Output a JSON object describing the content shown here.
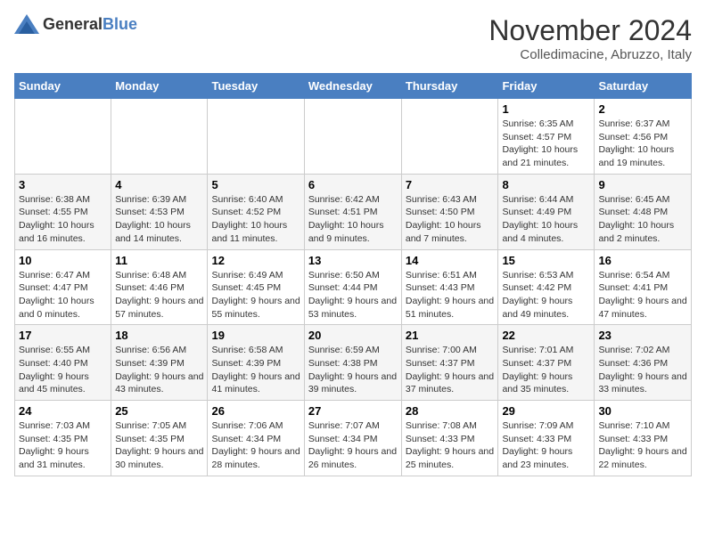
{
  "logo": {
    "text_general": "General",
    "text_blue": "Blue"
  },
  "title": {
    "month": "November 2024",
    "location": "Colledimacine, Abruzzo, Italy"
  },
  "headers": [
    "Sunday",
    "Monday",
    "Tuesday",
    "Wednesday",
    "Thursday",
    "Friday",
    "Saturday"
  ],
  "weeks": [
    [
      {
        "day": "",
        "sunrise": "",
        "sunset": "",
        "daylight": ""
      },
      {
        "day": "",
        "sunrise": "",
        "sunset": "",
        "daylight": ""
      },
      {
        "day": "",
        "sunrise": "",
        "sunset": "",
        "daylight": ""
      },
      {
        "day": "",
        "sunrise": "",
        "sunset": "",
        "daylight": ""
      },
      {
        "day": "",
        "sunrise": "",
        "sunset": "",
        "daylight": ""
      },
      {
        "day": "1",
        "sunrise": "Sunrise: 6:35 AM",
        "sunset": "Sunset: 4:57 PM",
        "daylight": "Daylight: 10 hours and 21 minutes."
      },
      {
        "day": "2",
        "sunrise": "Sunrise: 6:37 AM",
        "sunset": "Sunset: 4:56 PM",
        "daylight": "Daylight: 10 hours and 19 minutes."
      }
    ],
    [
      {
        "day": "3",
        "sunrise": "Sunrise: 6:38 AM",
        "sunset": "Sunset: 4:55 PM",
        "daylight": "Daylight: 10 hours and 16 minutes."
      },
      {
        "day": "4",
        "sunrise": "Sunrise: 6:39 AM",
        "sunset": "Sunset: 4:53 PM",
        "daylight": "Daylight: 10 hours and 14 minutes."
      },
      {
        "day": "5",
        "sunrise": "Sunrise: 6:40 AM",
        "sunset": "Sunset: 4:52 PM",
        "daylight": "Daylight: 10 hours and 11 minutes."
      },
      {
        "day": "6",
        "sunrise": "Sunrise: 6:42 AM",
        "sunset": "Sunset: 4:51 PM",
        "daylight": "Daylight: 10 hours and 9 minutes."
      },
      {
        "day": "7",
        "sunrise": "Sunrise: 6:43 AM",
        "sunset": "Sunset: 4:50 PM",
        "daylight": "Daylight: 10 hours and 7 minutes."
      },
      {
        "day": "8",
        "sunrise": "Sunrise: 6:44 AM",
        "sunset": "Sunset: 4:49 PM",
        "daylight": "Daylight: 10 hours and 4 minutes."
      },
      {
        "day": "9",
        "sunrise": "Sunrise: 6:45 AM",
        "sunset": "Sunset: 4:48 PM",
        "daylight": "Daylight: 10 hours and 2 minutes."
      }
    ],
    [
      {
        "day": "10",
        "sunrise": "Sunrise: 6:47 AM",
        "sunset": "Sunset: 4:47 PM",
        "daylight": "Daylight: 10 hours and 0 minutes."
      },
      {
        "day": "11",
        "sunrise": "Sunrise: 6:48 AM",
        "sunset": "Sunset: 4:46 PM",
        "daylight": "Daylight: 9 hours and 57 minutes."
      },
      {
        "day": "12",
        "sunrise": "Sunrise: 6:49 AM",
        "sunset": "Sunset: 4:45 PM",
        "daylight": "Daylight: 9 hours and 55 minutes."
      },
      {
        "day": "13",
        "sunrise": "Sunrise: 6:50 AM",
        "sunset": "Sunset: 4:44 PM",
        "daylight": "Daylight: 9 hours and 53 minutes."
      },
      {
        "day": "14",
        "sunrise": "Sunrise: 6:51 AM",
        "sunset": "Sunset: 4:43 PM",
        "daylight": "Daylight: 9 hours and 51 minutes."
      },
      {
        "day": "15",
        "sunrise": "Sunrise: 6:53 AM",
        "sunset": "Sunset: 4:42 PM",
        "daylight": "Daylight: 9 hours and 49 minutes."
      },
      {
        "day": "16",
        "sunrise": "Sunrise: 6:54 AM",
        "sunset": "Sunset: 4:41 PM",
        "daylight": "Daylight: 9 hours and 47 minutes."
      }
    ],
    [
      {
        "day": "17",
        "sunrise": "Sunrise: 6:55 AM",
        "sunset": "Sunset: 4:40 PM",
        "daylight": "Daylight: 9 hours and 45 minutes."
      },
      {
        "day": "18",
        "sunrise": "Sunrise: 6:56 AM",
        "sunset": "Sunset: 4:39 PM",
        "daylight": "Daylight: 9 hours and 43 minutes."
      },
      {
        "day": "19",
        "sunrise": "Sunrise: 6:58 AM",
        "sunset": "Sunset: 4:39 PM",
        "daylight": "Daylight: 9 hours and 41 minutes."
      },
      {
        "day": "20",
        "sunrise": "Sunrise: 6:59 AM",
        "sunset": "Sunset: 4:38 PM",
        "daylight": "Daylight: 9 hours and 39 minutes."
      },
      {
        "day": "21",
        "sunrise": "Sunrise: 7:00 AM",
        "sunset": "Sunset: 4:37 PM",
        "daylight": "Daylight: 9 hours and 37 minutes."
      },
      {
        "day": "22",
        "sunrise": "Sunrise: 7:01 AM",
        "sunset": "Sunset: 4:37 PM",
        "daylight": "Daylight: 9 hours and 35 minutes."
      },
      {
        "day": "23",
        "sunrise": "Sunrise: 7:02 AM",
        "sunset": "Sunset: 4:36 PM",
        "daylight": "Daylight: 9 hours and 33 minutes."
      }
    ],
    [
      {
        "day": "24",
        "sunrise": "Sunrise: 7:03 AM",
        "sunset": "Sunset: 4:35 PM",
        "daylight": "Daylight: 9 hours and 31 minutes."
      },
      {
        "day": "25",
        "sunrise": "Sunrise: 7:05 AM",
        "sunset": "Sunset: 4:35 PM",
        "daylight": "Daylight: 9 hours and 30 minutes."
      },
      {
        "day": "26",
        "sunrise": "Sunrise: 7:06 AM",
        "sunset": "Sunset: 4:34 PM",
        "daylight": "Daylight: 9 hours and 28 minutes."
      },
      {
        "day": "27",
        "sunrise": "Sunrise: 7:07 AM",
        "sunset": "Sunset: 4:34 PM",
        "daylight": "Daylight: 9 hours and 26 minutes."
      },
      {
        "day": "28",
        "sunrise": "Sunrise: 7:08 AM",
        "sunset": "Sunset: 4:33 PM",
        "daylight": "Daylight: 9 hours and 25 minutes."
      },
      {
        "day": "29",
        "sunrise": "Sunrise: 7:09 AM",
        "sunset": "Sunset: 4:33 PM",
        "daylight": "Daylight: 9 hours and 23 minutes."
      },
      {
        "day": "30",
        "sunrise": "Sunrise: 7:10 AM",
        "sunset": "Sunset: 4:33 PM",
        "daylight": "Daylight: 9 hours and 22 minutes."
      }
    ]
  ]
}
